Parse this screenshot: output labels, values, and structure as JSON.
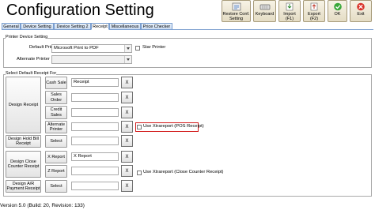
{
  "window": {
    "title": "Configuration Setting"
  },
  "toolbar": {
    "buttons": [
      {
        "id": "restore",
        "label_line1": "Restore Conf.",
        "label_line2": "Setting",
        "icon": "restore-icon"
      },
      {
        "id": "keyboard",
        "label_line1": "Keyboard",
        "label_line2": "",
        "icon": "keyboard-icon"
      },
      {
        "id": "import",
        "label_line1": "Import",
        "label_line2": "(F1)",
        "icon": "import-icon"
      },
      {
        "id": "export",
        "label_line1": "Export",
        "label_line2": "(F2)",
        "icon": "export-icon"
      },
      {
        "id": "ok",
        "label_line1": "OK",
        "label_line2": "",
        "icon": "check-icon"
      },
      {
        "id": "exit",
        "label_line1": "Exit",
        "label_line2": "",
        "icon": "exit-icon"
      }
    ]
  },
  "tabs": [
    {
      "label": "General",
      "active": false
    },
    {
      "label": "Device Setting",
      "active": false
    },
    {
      "label": "Device Setting 2",
      "active": false
    },
    {
      "label": "Receipt",
      "active": true
    },
    {
      "label": "Miscellaneous",
      "active": false
    },
    {
      "label": "Price Checker",
      "active": false
    }
  ],
  "printer_group": {
    "label": "Printer Device Setting",
    "default_printer_label": "Default Printer",
    "default_printer_value": "Microsoft Print to PDF",
    "star_printer_label": "Star Printer",
    "alternate_printer_label": "Alternate Printer",
    "alternate_printer_value": ""
  },
  "receipt_group": {
    "label": "Select Default Receipt For",
    "design_receipt_label": "Design Receipt",
    "design_hold_bill_label": "Design Hold Bill Receipt",
    "design_close_counter_label": "Design Close Counter Receipt",
    "design_ar_label": "Design A/R Payment Receipt",
    "rows": [
      {
        "button": "Cash Sale",
        "value": "Receipt",
        "x": "X"
      },
      {
        "button": "Sales Order",
        "value": "",
        "x": "X"
      },
      {
        "button": "Credit Sales",
        "value": "",
        "x": "X"
      },
      {
        "button": "Alternate Printer",
        "value": "",
        "x": "X"
      },
      {
        "button": "Select",
        "value": "",
        "x": "X"
      },
      {
        "button": "X Report",
        "value": "X Report",
        "x": "X"
      },
      {
        "button": "Z Report",
        "value": "",
        "x": "X"
      },
      {
        "button": "Select",
        "value": "",
        "x": "X"
      }
    ],
    "use_xtrareport_pos": "Use Xtrareport (POS Receipt)",
    "use_xtrareport_close": "Use Xtrareport (Close Counter Receipt)"
  },
  "status": {
    "version": "Version 5.0 (Build: 20, Revision: 133)"
  },
  "colors": {
    "tab_border": "#7a9ecf",
    "highlight": "#d21a1a",
    "toolbar_bg": "#ece4cf"
  }
}
